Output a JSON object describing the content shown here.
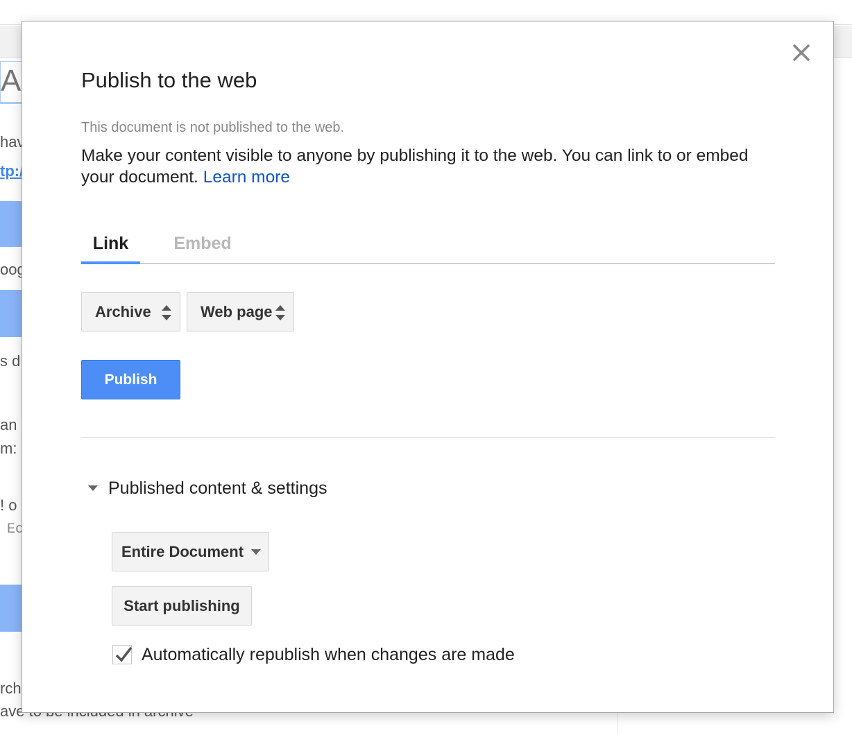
{
  "background": {
    "title_fragment": "A(",
    "text_fragments": [
      "hav",
      "oog",
      "s d",
      "an",
      "m:",
      "! o",
      "rch",
      "ave to be included in archive"
    ],
    "link_fragment": "tp:/",
    "mono_fragment": "Ec"
  },
  "dialog": {
    "title": "Publish to the web",
    "close_icon": "close-icon",
    "status": "This document is not published to the web.",
    "description": "Make your content visible to anyone by publishing it to the web. You can link to or embed your document.",
    "learn_more": "Learn more",
    "tabs": [
      {
        "label": "Link",
        "active": true
      },
      {
        "label": "Embed",
        "active": false
      }
    ],
    "selects": {
      "content": "Archive",
      "format": "Web page"
    },
    "publish_label": "Publish",
    "section": {
      "label": "Published content & settings",
      "scope": "Entire Document",
      "start_publishing_label": "Start publishing",
      "auto_republish_label": "Automatically republish when changes are made",
      "auto_republish_checked": true
    }
  },
  "colors": {
    "accent": "#4d8ef6",
    "link": "#1155cc",
    "tab_underline": "#4d90fe"
  }
}
